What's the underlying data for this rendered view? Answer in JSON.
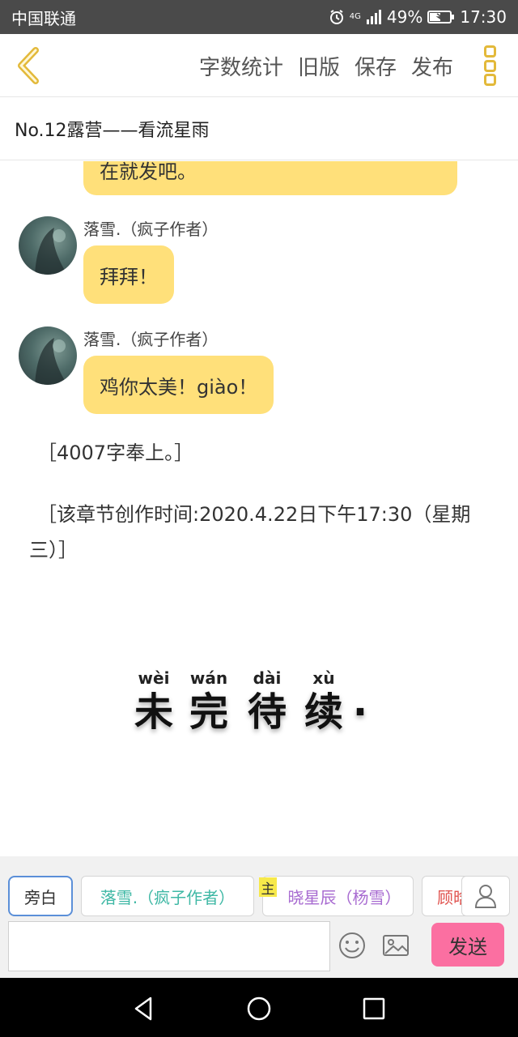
{
  "status_bar": {
    "carrier": "中国联通",
    "network": "4G",
    "battery": "49%",
    "time": "17:30",
    "icons": [
      "alarm-icon",
      "signal-icon",
      "battery-icon"
    ]
  },
  "header": {
    "back_icon": "chevron-left-icon",
    "actions": [
      "字数统计",
      "旧版",
      "保存",
      "发布"
    ],
    "more_icon": "more-vertical-icon"
  },
  "chapter_title": "No.12露营——看流星雨",
  "messages": [
    {
      "text": "在就发吧。",
      "partial": true
    },
    {
      "author": "落雪.（疯子作者）",
      "text": "拜拜！"
    },
    {
      "author": "落雪.（疯子作者）",
      "text": "鸡你太美！giào！"
    }
  ],
  "narration": [
    "［4007字奉上。］",
    "［该章节创作时间:2020.4.22日下午17:30（星期三）］"
  ],
  "to_be_continued": {
    "pinyin": [
      "wèi",
      "wán",
      "dài",
      "xù"
    ],
    "hanzi": [
      "未",
      "完",
      "待",
      "续"
    ],
    "dot": "·"
  },
  "roles": {
    "items": [
      {
        "label": "旁白",
        "color": "#333333"
      },
      {
        "label": "落雪.（疯子作者）",
        "color": "#3fb8a5"
      },
      {
        "label": "晓星辰（杨雪）",
        "color": "#a86bd1"
      },
      {
        "label": "顾晗",
        "color": "#e0534f"
      }
    ],
    "main_tag": "主",
    "person_icon": "person-icon"
  },
  "input": {
    "placeholder": "",
    "value": "",
    "emoji_icon": "smiley-icon",
    "image_icon": "image-icon",
    "send_label": "发送"
  },
  "nav": {
    "icons": [
      "back-triangle-icon",
      "home-circle-icon",
      "recents-square-icon"
    ]
  },
  "colors": {
    "accent": "#e3b93a",
    "bubble": "#ffe07a",
    "send": "#fb6fa1"
  }
}
